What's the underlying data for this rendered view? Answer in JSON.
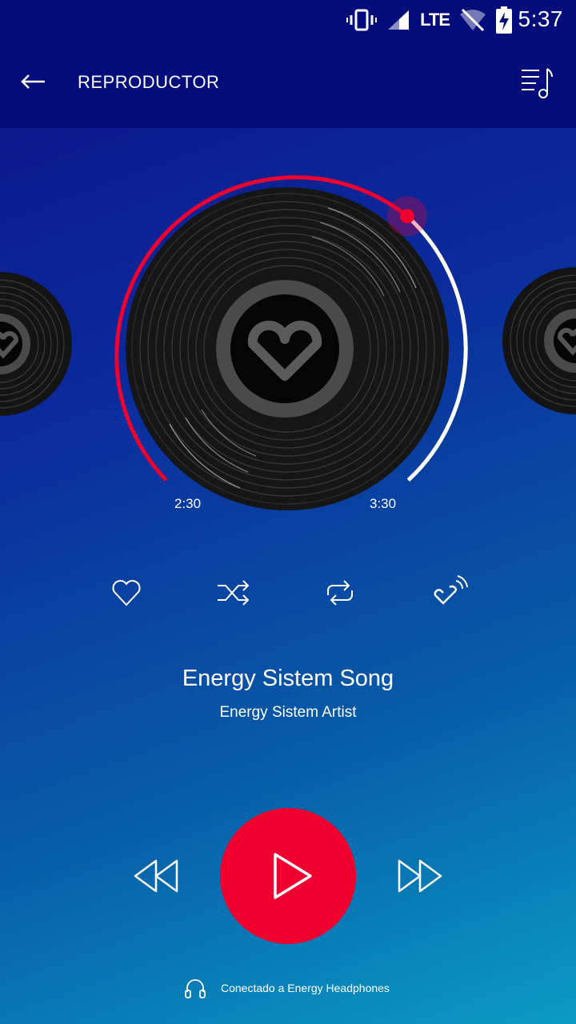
{
  "status_bar": {
    "time": "5:37",
    "network": "LTE",
    "icons": [
      "vibrate-icon",
      "signal-icon",
      "lte-label",
      "wifi-off-icon",
      "battery-charging-icon"
    ]
  },
  "app_bar": {
    "title": "REPRODUCTOR",
    "back_icon": "arrow-left-icon",
    "queue_icon": "playlist-music-icon"
  },
  "player": {
    "elapsed": "2:30",
    "total": "3:30",
    "progress": 0.714,
    "accent_color": "#f0002e"
  },
  "actions": [
    {
      "name": "favorite",
      "icon": "heart-outline-icon"
    },
    {
      "name": "shuffle",
      "icon": "shuffle-icon"
    },
    {
      "name": "repeat",
      "icon": "repeat-icon"
    },
    {
      "name": "broadcast",
      "icon": "brand-check-wireless-icon"
    }
  ],
  "song": {
    "title": "Energy Sistem Song",
    "artist": "Energy Sistem Artist"
  },
  "controls": {
    "rewind_icon": "rewind-icon",
    "play_icon": "play-icon",
    "forward_icon": "fast-forward-icon"
  },
  "connection": {
    "icon": "headphones-icon",
    "text": "Conectado a Energy Headphones"
  }
}
